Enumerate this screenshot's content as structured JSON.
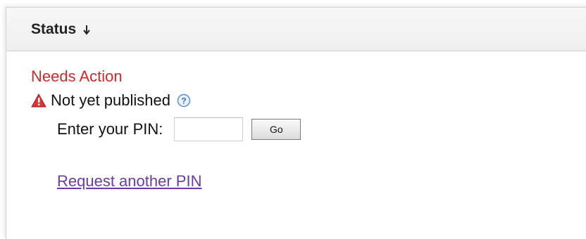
{
  "header": {
    "title": "Status",
    "sort_icon": "arrow-down-icon"
  },
  "status": {
    "heading": "Needs Action",
    "heading_color": "#cc2a2a",
    "state_icon": "warning-icon",
    "state_text": "Not yet published",
    "help_icon": "help-icon"
  },
  "pin": {
    "label": "Enter your PIN:",
    "input_value": "",
    "submit_label": "Go"
  },
  "link": {
    "request_pin_label": "Request another PIN",
    "color": "#6a3aa8"
  }
}
